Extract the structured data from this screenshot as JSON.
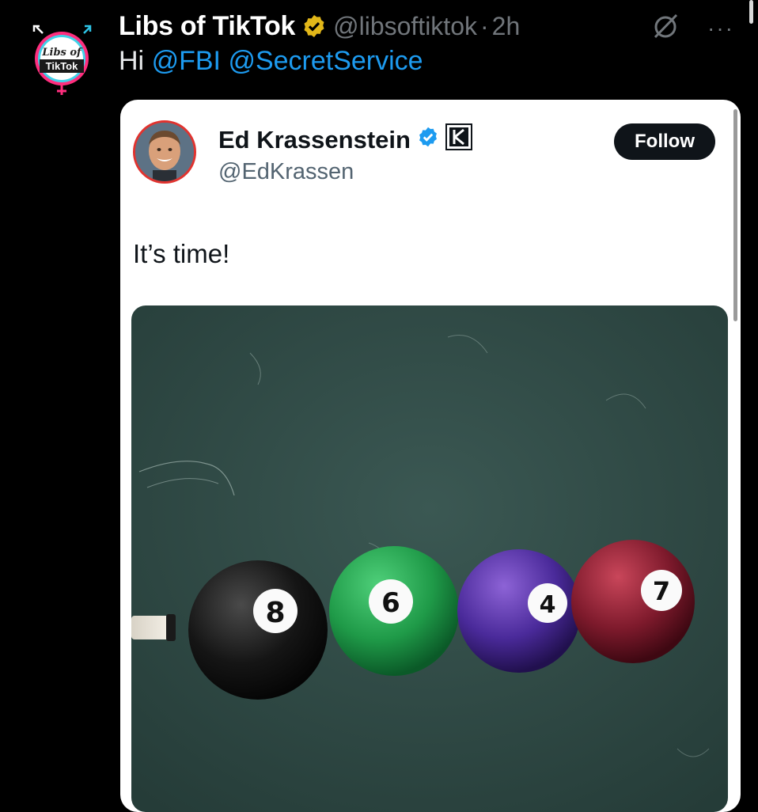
{
  "tweet": {
    "author_name": "Libs of TikTok",
    "author_handle": "@libsoftiktok",
    "separator": "·",
    "time": "2h",
    "text_prefix": "Hi ",
    "mentions": [
      "@FBI",
      "@SecretService"
    ],
    "avatar_text": [
      "Libs of",
      "TikTok"
    ],
    "more_label": "···"
  },
  "quoted": {
    "name": "Ed Krassenstein",
    "handle": "@EdKrassen",
    "follow_label": "Follow",
    "text": "It’s time!",
    "image": {
      "balls": [
        "8",
        "6",
        "4",
        "7"
      ]
    }
  },
  "colors": {
    "background": "#000000",
    "mention": "#1d9bf0",
    "gold_badge": "#e2b719",
    "blue_badge": "#1d9bf0",
    "felt": "#2f4a46"
  },
  "icons": [
    "gold-verified-icon",
    "grok-slash-icon",
    "more-icon",
    "blue-verified-icon",
    "affiliate-k-icon"
  ]
}
